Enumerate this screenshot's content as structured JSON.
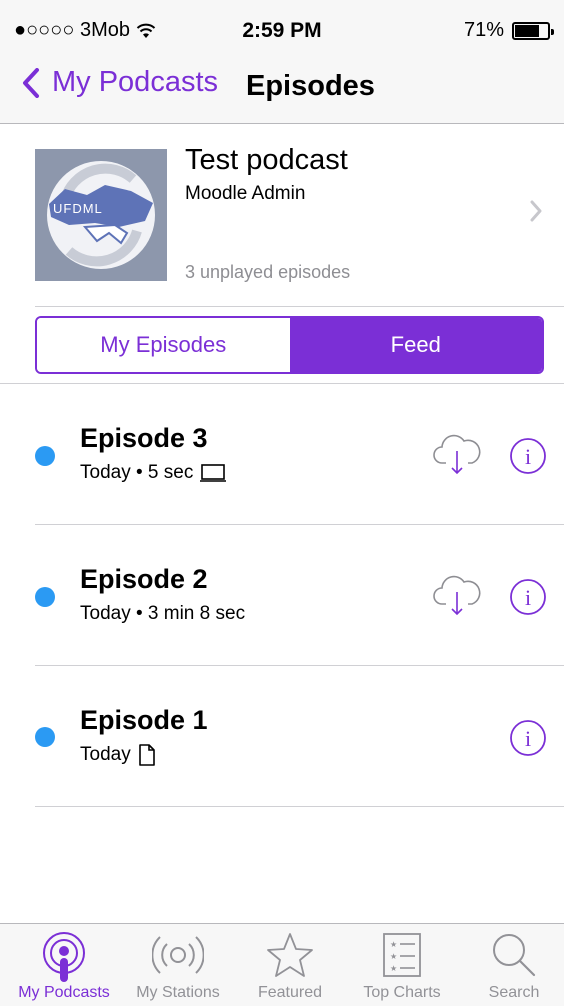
{
  "status_bar": {
    "carrier": "●○○○○ 3Mob",
    "time": "2:59 PM",
    "battery": "71%"
  },
  "nav": {
    "back_label": "My Podcasts",
    "title": "Episodes"
  },
  "podcast": {
    "title": "Test podcast",
    "author": "Moodle Admin",
    "artwork_text": "UFDML",
    "unplayed": "3 unplayed episodes"
  },
  "segment": {
    "options": [
      "My Episodes",
      "Feed"
    ],
    "selected": "Feed"
  },
  "episodes": [
    {
      "title": "Episode 3",
      "meta": "Today • 5 sec",
      "media_icon": "video-icon",
      "downloadable": true
    },
    {
      "title": "Episode 2",
      "meta": "Today • 3 min 8 sec",
      "media_icon": "",
      "downloadable": true
    },
    {
      "title": "Episode 1",
      "meta": "Today",
      "media_icon": "document-icon",
      "downloadable": false
    }
  ],
  "tabs": [
    {
      "label": "My Podcasts",
      "icon": "podcast-icon",
      "active": true
    },
    {
      "label": "My Stations",
      "icon": "stations-icon",
      "active": false
    },
    {
      "label": "Featured",
      "icon": "star-icon",
      "active": false
    },
    {
      "label": "Top Charts",
      "icon": "list-icon",
      "active": false
    },
    {
      "label": "Search",
      "icon": "search-icon",
      "active": false
    }
  ],
  "colors": {
    "accent": "#7b2fd6",
    "unplayed_dot": "#2b9af3",
    "secondary_text": "#8e8e93"
  }
}
